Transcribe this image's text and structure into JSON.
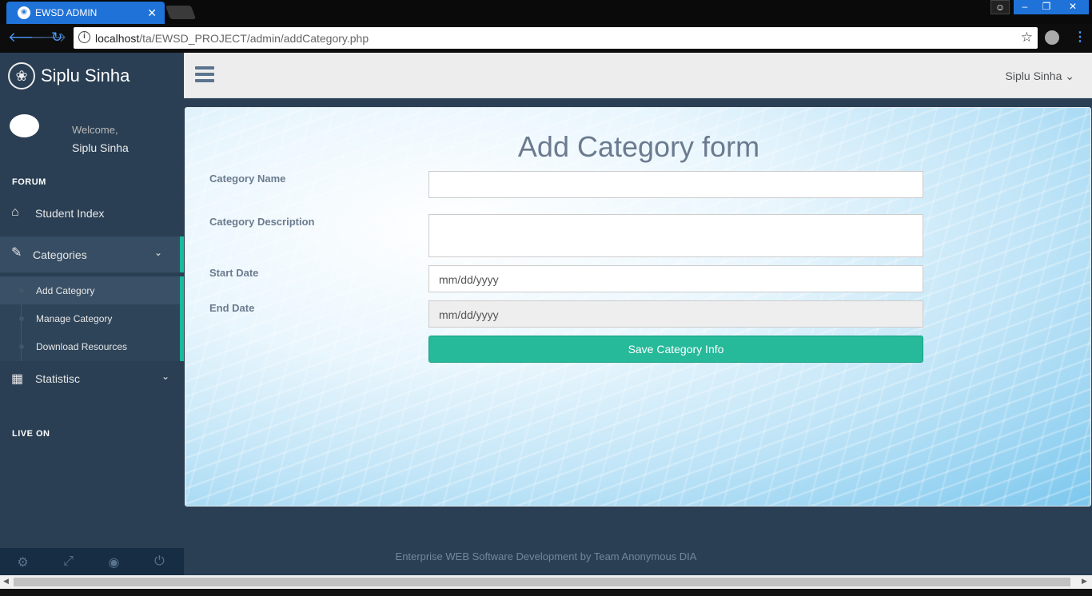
{
  "browser": {
    "tab_title": "EWSD ADMIN",
    "tab_close": "✕",
    "url_host": "localhost",
    "url_path": "/ta/EWSD_PROJECT/admin/addCategory.php",
    "window_controls": {
      "minimize": "–",
      "maximize": "❐",
      "close": "✕"
    }
  },
  "sidebar": {
    "brand": "Siplu Sinha",
    "welcome": "Welcome,",
    "profile_name": "Siplu Sinha",
    "section_forum": "FORUM",
    "section_live": "LIVE ON",
    "items": [
      {
        "label": "Student Index",
        "icon": "home-icon"
      },
      {
        "label": "Categories",
        "icon": "edit-icon"
      },
      {
        "label": "Statistisc",
        "icon": "table-icon"
      }
    ],
    "sub_items": [
      {
        "label": "Add Category"
      },
      {
        "label": "Manage Category"
      },
      {
        "label": "Download Resources"
      }
    ],
    "footer_icons": [
      "settings-icon",
      "fullscreen-icon",
      "lock-icon",
      "power-icon"
    ]
  },
  "topnav": {
    "user_name": "Siplu Sinha"
  },
  "form": {
    "title": "Add Category form",
    "category_name_label": "Category Name",
    "category_name_value": "",
    "category_description_label": "Category Description",
    "category_description_value": "",
    "start_date_label": "Start Date",
    "start_date_placeholder": "mm/dd/yyyy",
    "end_date_label": "End Date",
    "end_date_placeholder": "mm/dd/yyyy",
    "submit_label": "Save Category Info"
  },
  "footer": {
    "text": "Enterprise WEB Software Development by Team Anonymous DIA"
  },
  "colors": {
    "sidebar_bg": "#2a3f54",
    "accent": "#1abb9c",
    "button_green": "#26b99a",
    "chrome_blue": "#1f72d8"
  }
}
